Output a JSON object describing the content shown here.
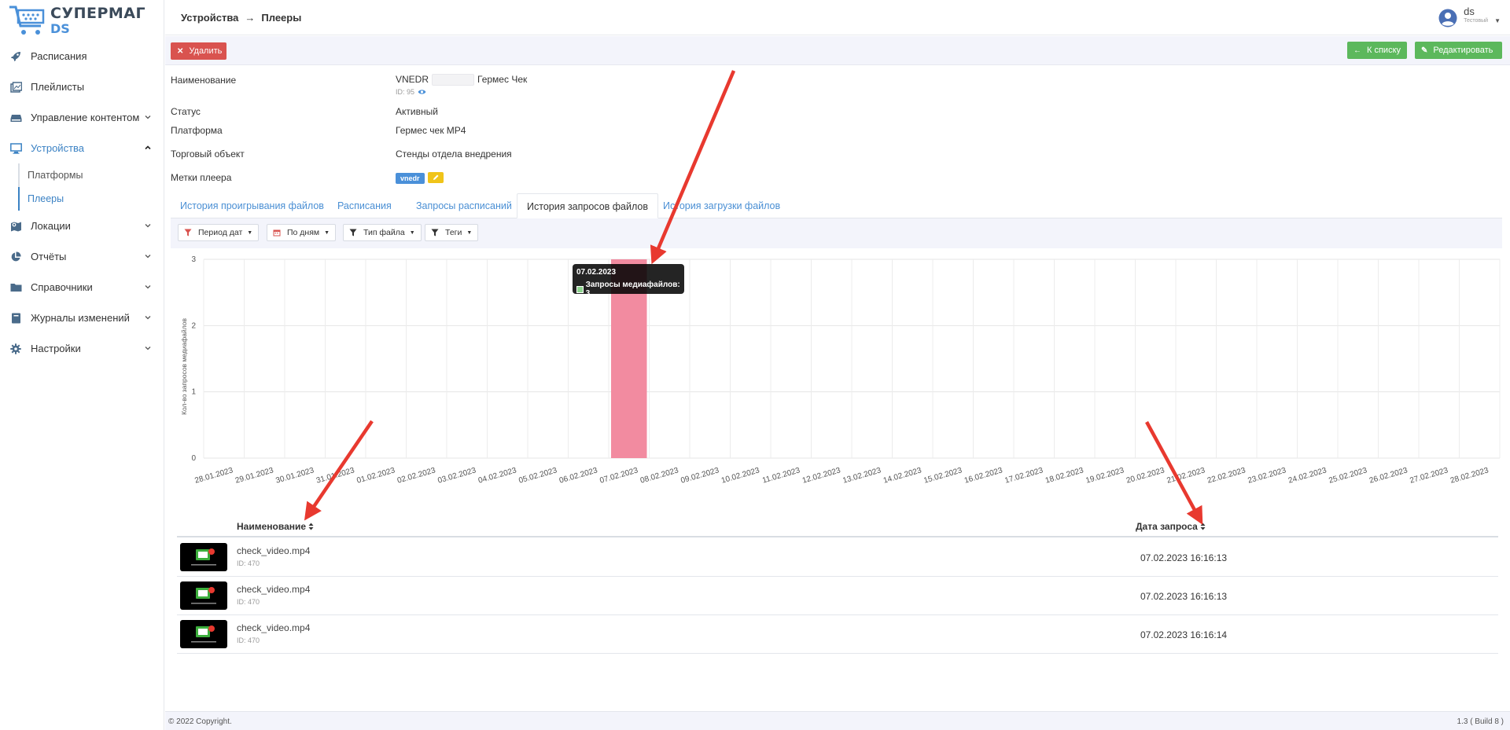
{
  "app": {
    "logo_main": "СУПЕРМАГ",
    "logo_sub": "DS"
  },
  "sidebar": {
    "items": [
      {
        "label": "Расписания",
        "icon": "rocket-icon"
      },
      {
        "label": "Плейлисты",
        "icon": "playlist-icon"
      },
      {
        "label": "Управление контентом",
        "icon": "hdd-icon",
        "expandable": true
      },
      {
        "label": "Устройства",
        "icon": "monitor-icon",
        "expanded": true,
        "active": true
      },
      {
        "label": "Локации",
        "icon": "map-icon",
        "expandable": true
      },
      {
        "label": "Отчёты",
        "icon": "pie-chart-icon",
        "expandable": true
      },
      {
        "label": "Справочники",
        "icon": "folder-icon",
        "expandable": true
      },
      {
        "label": "Журналы изменений",
        "icon": "book-icon",
        "expandable": true
      },
      {
        "label": "Настройки",
        "icon": "gear-icon",
        "expandable": true
      }
    ],
    "sub_items": [
      {
        "label": "Платформы"
      },
      {
        "label": "Плееры",
        "active": true
      }
    ]
  },
  "header": {
    "breadcrumb": [
      "Устройства",
      "Плееры"
    ],
    "breadcrumb_sep": "→",
    "user_name": "ds",
    "user_role": "Тестовый"
  },
  "actions": {
    "delete_label": "Удалить",
    "to_list_label": "К списку",
    "edit_label": "Редактировать"
  },
  "player": {
    "name_label": "Наименование",
    "name_prefix": "VNEDR",
    "name_suffix": "Гермес Чек",
    "id_text": "ID: 95",
    "status_label": "Статус",
    "status_value": "Активный",
    "platform_label": "Платформа",
    "platform_value": "Гермес чек MP4",
    "store_label": "Торговый объект",
    "store_value": "Стенды отдела внедрения",
    "tags_label": "Метки плеера",
    "tag": "vnedr"
  },
  "tabs": [
    {
      "label": "История проигрывания файлов"
    },
    {
      "label": "Расписания"
    },
    {
      "label": "Запросы расписаний"
    },
    {
      "label": "История запросов файлов",
      "active": true
    },
    {
      "label": "История загрузки файлов"
    }
  ],
  "filters": [
    {
      "label": "Период дат",
      "icon": "filter-icon"
    },
    {
      "label": "По дням",
      "icon": "calendar-icon"
    },
    {
      "label": "Тип файла",
      "icon": "filter-icon"
    },
    {
      "label": "Теги",
      "icon": "filter-icon"
    }
  ],
  "chart_data": {
    "type": "bar",
    "ylabel": "Кол-во запросов медиафайлов",
    "ylim": [
      0,
      3
    ],
    "yticks": [
      0,
      1,
      2,
      3
    ],
    "bar_color": "#f28ba0",
    "categories": [
      "28.01.2023",
      "29.01.2023",
      "30.01.2023",
      "31.01.2023",
      "01.02.2023",
      "02.02.2023",
      "03.02.2023",
      "04.02.2023",
      "05.02.2023",
      "06.02.2023",
      "07.02.2023",
      "08.02.2023",
      "09.02.2023",
      "10.02.2023",
      "11.02.2023",
      "12.02.2023",
      "13.02.2023",
      "14.02.2023",
      "15.02.2023",
      "16.02.2023",
      "17.02.2023",
      "18.02.2023",
      "19.02.2023",
      "20.02.2023",
      "21.02.2023",
      "22.02.2023",
      "23.02.2023",
      "24.02.2023",
      "25.02.2023",
      "26.02.2023",
      "27.02.2023",
      "28.02.2023"
    ],
    "series": [
      {
        "name": "Запросы медиафайлов",
        "values": [
          0,
          0,
          0,
          0,
          0,
          0,
          0,
          0,
          0,
          0,
          3,
          0,
          0,
          0,
          0,
          0,
          0,
          0,
          0,
          0,
          0,
          0,
          0,
          0,
          0,
          0,
          0,
          0,
          0,
          0,
          0,
          0
        ]
      }
    ],
    "grid": true,
    "legend": "none"
  },
  "tooltip": {
    "title": "07.02.2023",
    "text": "Запросы медиафайлов: 3"
  },
  "table": {
    "col_name": "Наименование",
    "col_date": "Дата запроса",
    "rows": [
      {
        "name": "check_video.mp4",
        "id": "ID: 470",
        "date": "07.02.2023 16:16:13"
      },
      {
        "name": "check_video.mp4",
        "id": "ID: 470",
        "date": "07.02.2023 16:16:13"
      },
      {
        "name": "check_video.mp4",
        "id": "ID: 470",
        "date": "07.02.2023 16:16:14"
      }
    ]
  },
  "footer": {
    "copyright": "© 2022 Copyright.",
    "version": "1.3 ( Build 8 )"
  },
  "colors": {
    "accent": "#3b82c4",
    "danger": "#d9534f",
    "success": "#5cb85c",
    "arrow": "#e8392f"
  }
}
